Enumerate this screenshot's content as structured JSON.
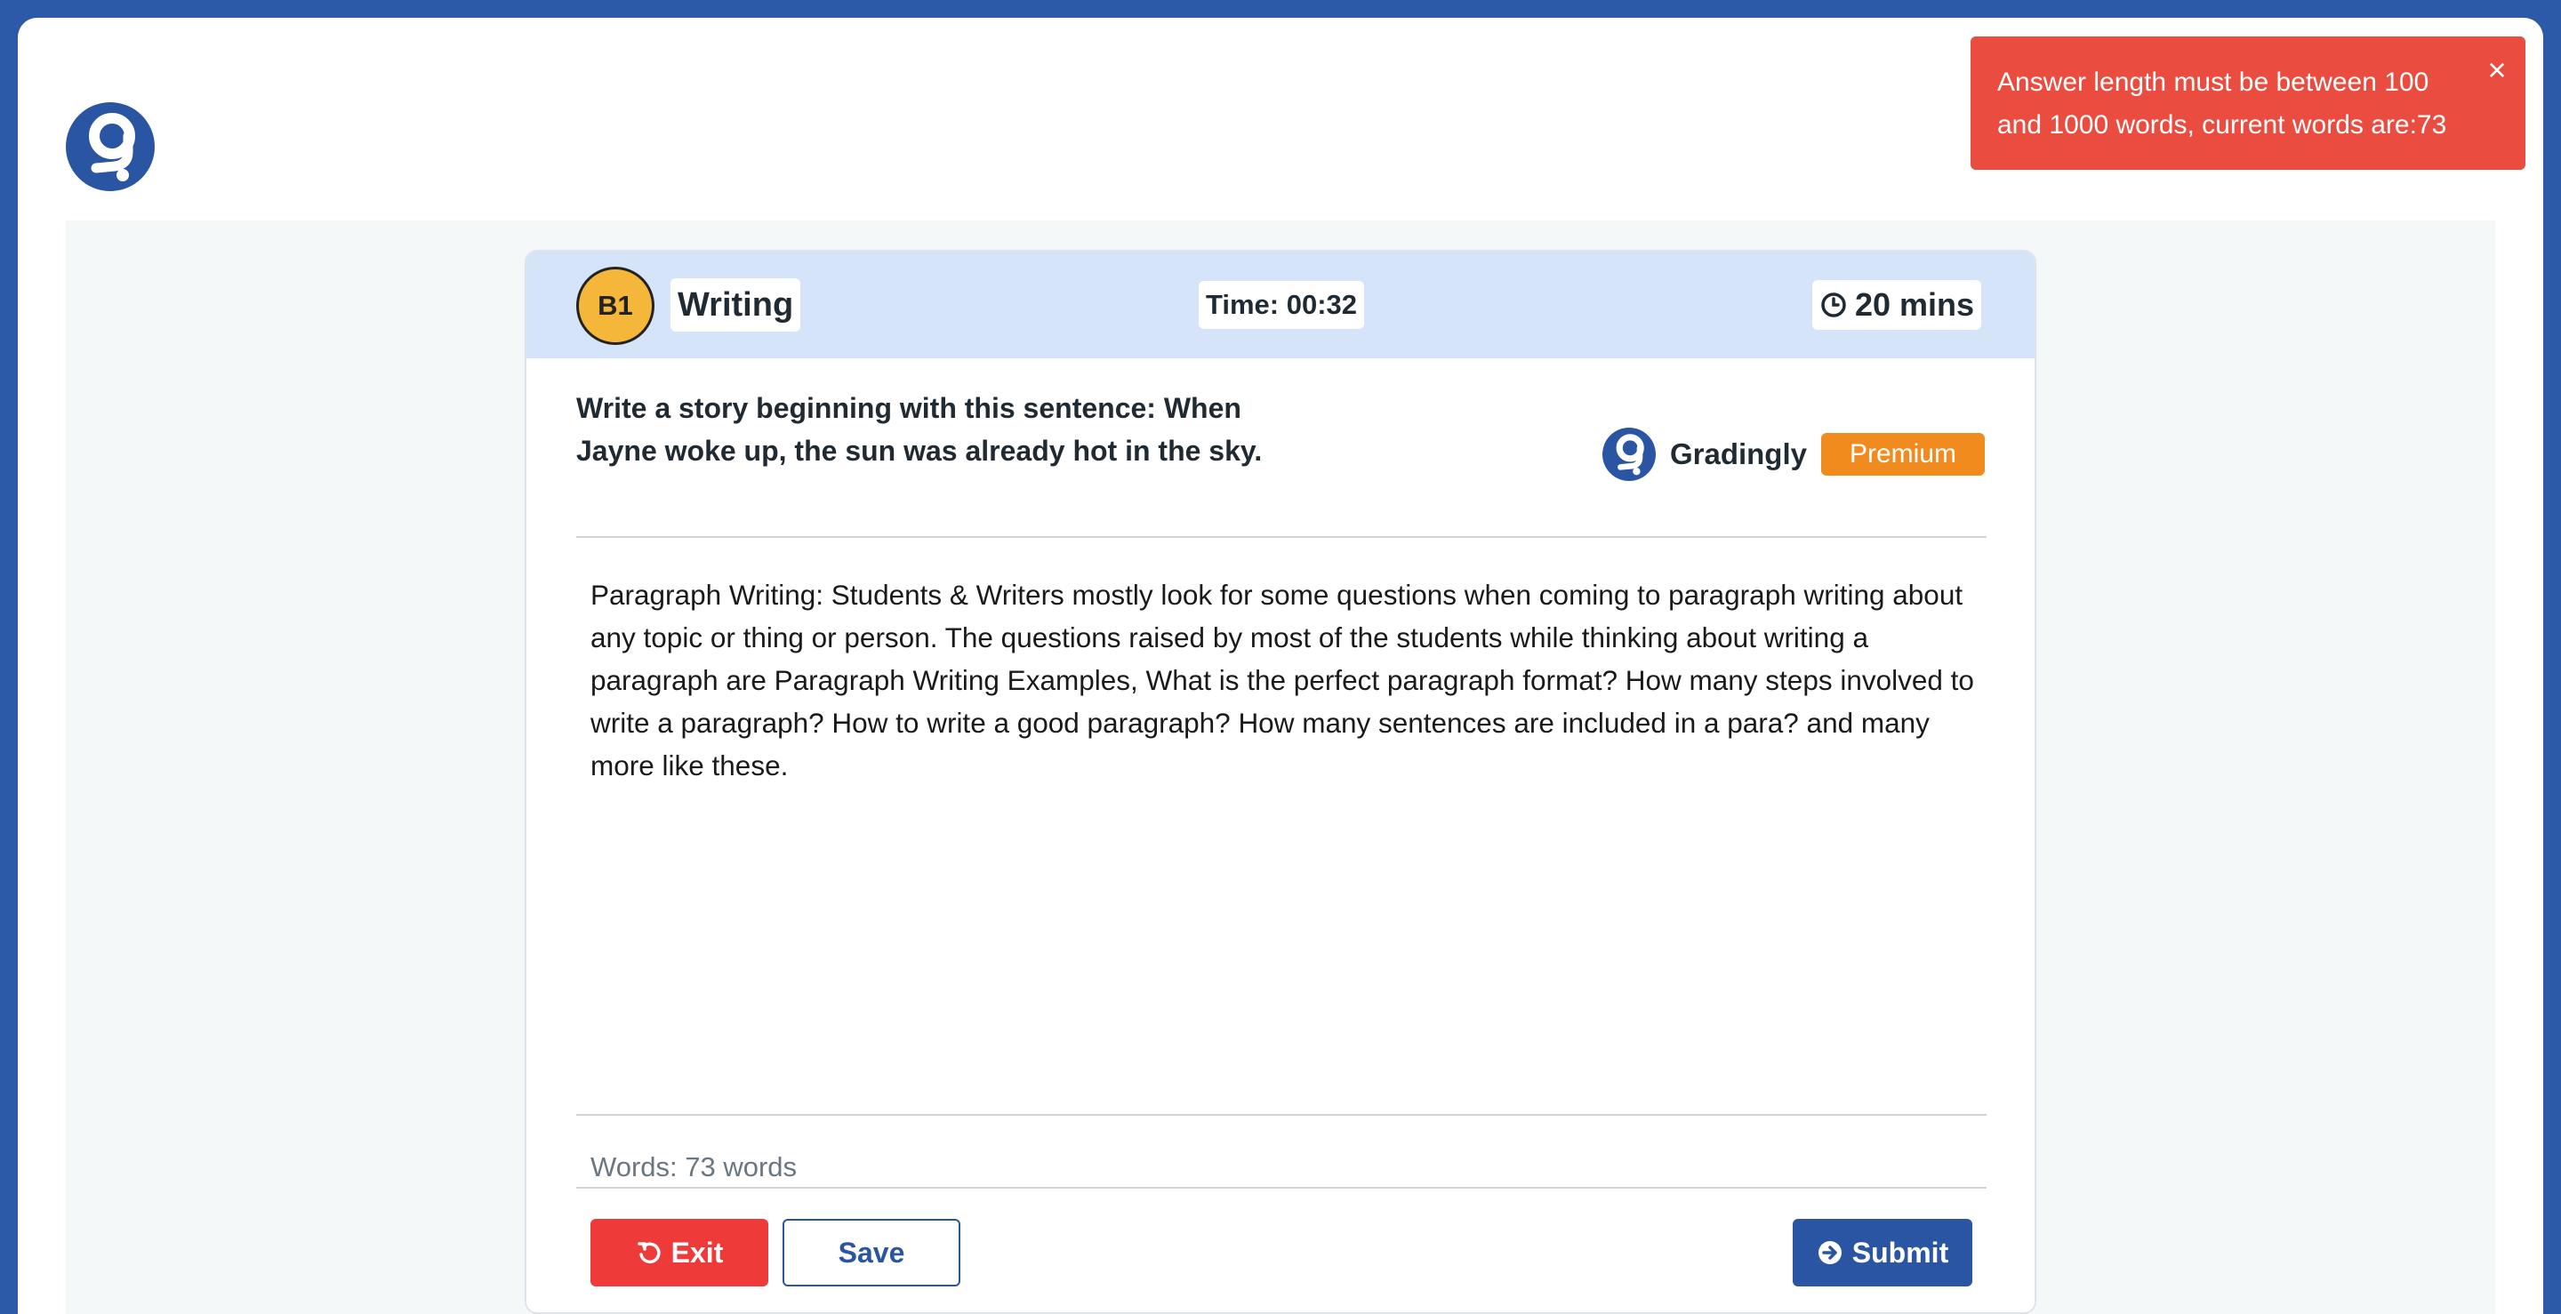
{
  "brand": {
    "logo_icon": "gradingly-logo-icon",
    "name": "Gradingly",
    "badge": "Premium"
  },
  "colors": {
    "accent": "#2a55a3",
    "level": "#f4b73a",
    "exit": "#ef3a3a",
    "premium": "#f28b1e",
    "toast": "#ea4c3f"
  },
  "header": {
    "level": "B1",
    "section": "Writing",
    "timer": "Time: 00:32",
    "duration_icon": "clock-icon",
    "duration": "20 mins"
  },
  "question": "Write a story beginning with this sentence: When Jayne woke up, the sun was already hot in the sky.",
  "answer": "Paragraph Writing: Students & Writers mostly look for some questions when coming to paragraph writing about any topic or thing or person. The questions raised by most of the students while thinking about writing a paragraph are Paragraph Writing Examples, What is the perfect paragraph format? How many steps involved to write a paragraph? How to write a good paragraph? How many sentences are included in a para? and many more like these.",
  "footer": {
    "word_count": "Words: 73 words",
    "exit_label": "Exit",
    "exit_icon": "undo-icon",
    "save_label": "Save",
    "submit_label": "Submit",
    "submit_icon": "arrow-circle-right-icon"
  },
  "toast": {
    "message": "Answer length must be between 100 and 1000 words, current words are:73",
    "close": "×"
  }
}
